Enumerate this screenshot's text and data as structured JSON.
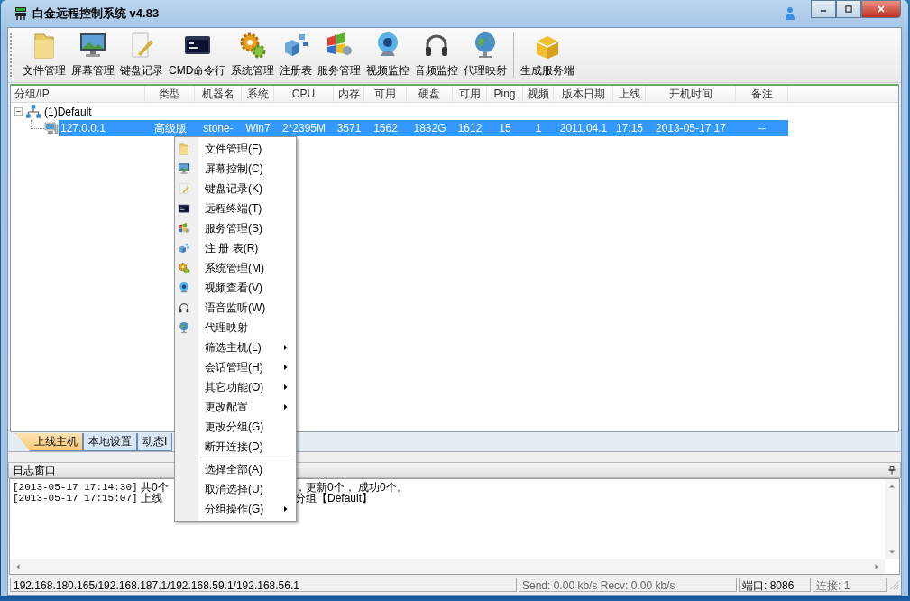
{
  "window": {
    "title": "白金远程控制系统 v4.83"
  },
  "toolbar": [
    {
      "label": "文件管理"
    },
    {
      "label": "屏幕管理"
    },
    {
      "label": "键盘记录"
    },
    {
      "label": "CMD命令行"
    },
    {
      "label": "系统管理"
    },
    {
      "label": "注册表"
    },
    {
      "label": "服务管理"
    },
    {
      "label": "视频监控"
    },
    {
      "label": "音频监控"
    },
    {
      "label": "代理映射"
    },
    {
      "label": "生成服务端",
      "separator_before": true
    }
  ],
  "table": {
    "columns": [
      "分组/IP",
      "类型",
      "机器名",
      "系统",
      "CPU",
      "内存",
      "可用",
      "硬盘",
      "可用",
      "Ping",
      "视频",
      "版本日期",
      "上线",
      "开机时间",
      "备注"
    ],
    "groups": [
      {
        "label": "(1)Default",
        "expanded": true,
        "children": [
          {
            "selected": true,
            "cells": [
              "127.0.0.1",
              "高级版",
              "stone-",
              "Win7",
              "2*2395M",
              "3571",
              "1562",
              "1832G",
              "1612",
              "15",
              "1",
              "2011.04.1",
              "17:15",
              "2013-05-17 17",
              "--"
            ]
          }
        ]
      }
    ]
  },
  "tabs": [
    {
      "label": "上线主机",
      "selected": true
    },
    {
      "label": "本地设置",
      "selected": false
    },
    {
      "label": "动态I",
      "selected": false
    }
  ],
  "log": {
    "title": "日志窗口",
    "entries": [
      {
        "time": "[2013-05-17 17:14:30]",
        "message_start": "共0个",
        "message_end": "，更新0个， 成功0个。"
      },
      {
        "time": "[2013-05-17 17:15:07]",
        "message_start": "上线",
        "message_end": "分组【Default】"
      }
    ]
  },
  "context_menu": [
    {
      "label": "文件管理(F)",
      "submenu": false
    },
    {
      "label": "屏幕控制(C)",
      "submenu": false
    },
    {
      "label": "键盘记录(K)",
      "submenu": false
    },
    {
      "label": "远程终端(T)",
      "submenu": false
    },
    {
      "label": "服务管理(S)",
      "submenu": false
    },
    {
      "label": "注 册 表(R)",
      "submenu": false
    },
    {
      "label": "系统管理(M)",
      "submenu": false
    },
    {
      "label": "视频查看(V)",
      "submenu": false
    },
    {
      "label": "语音监听(W)",
      "submenu": false
    },
    {
      "label": "代理映射",
      "submenu": false
    },
    {
      "label": "筛选主机(L)",
      "submenu": true
    },
    {
      "label": "会话管理(H)",
      "submenu": true
    },
    {
      "label": "其它功能(O)",
      "submenu": true
    },
    {
      "label": "更改配置",
      "submenu": true
    },
    {
      "label": "更改分组(G)",
      "submenu": false
    },
    {
      "label": "断开连接(D)",
      "submenu": false
    },
    {
      "label": "选择全部(A)",
      "submenu": false,
      "separator_before": true
    },
    {
      "label": "取消选择(U)",
      "submenu": false
    },
    {
      "label": "分组操作(G)",
      "submenu": true
    }
  ],
  "status_bar": [
    "192.168.180.165/192.168.187.1/192.168.59.1/192.168.56.1",
    "Send: 0.00 kb/s Recv: 0.00 kb/s",
    "端口: 8086",
    "连接: 1"
  ]
}
